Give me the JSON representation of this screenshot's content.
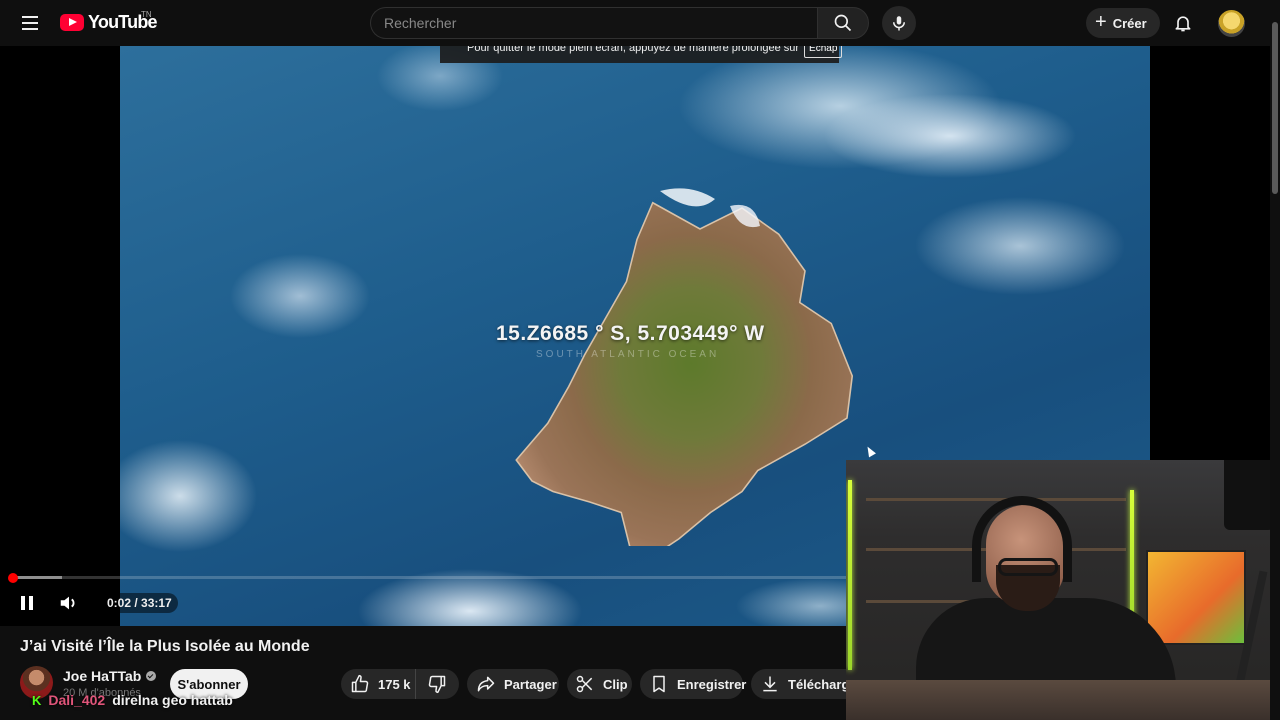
{
  "header": {
    "logo_text": "YouTube",
    "country_code": "TN",
    "search_placeholder": "Rechercher",
    "create_label": "Créer"
  },
  "player": {
    "fullscreen_hint": "Pour quitter le mode plein écran, appuyez de manière prolongée sur",
    "fullscreen_key": "Échap",
    "overlay_coordinates": "15.Z6685  ° S, 5.703449° W",
    "overlay_subtitle": "SOUTH ATLANTIC OCEAN",
    "current_time": "0:02",
    "duration": "33:17",
    "time_display": "0:02 / 33:17",
    "played_fraction": 0.001,
    "buffered_fraction": 0.06,
    "state": "playing"
  },
  "video": {
    "title": "J’ai Visité l’Île la Plus Isolée au Monde",
    "channel_name": "Joe HaTTab",
    "subscribers": "20 M d'abonnés",
    "subscribe_label": "S'abonner",
    "likes": "175 k",
    "share_label": "Partager",
    "clip_label": "Clip",
    "save_label": "Enregistrer",
    "download_label": "Télécharger"
  },
  "chat_overlay": {
    "badge": "K",
    "username": "Dali_402",
    "message": "direlna geo hattab"
  },
  "colors": {
    "accent_red": "#ff0000",
    "background": "#0f0f0f",
    "chat_username": "#e0557a",
    "chat_badge": "#53fc18"
  }
}
